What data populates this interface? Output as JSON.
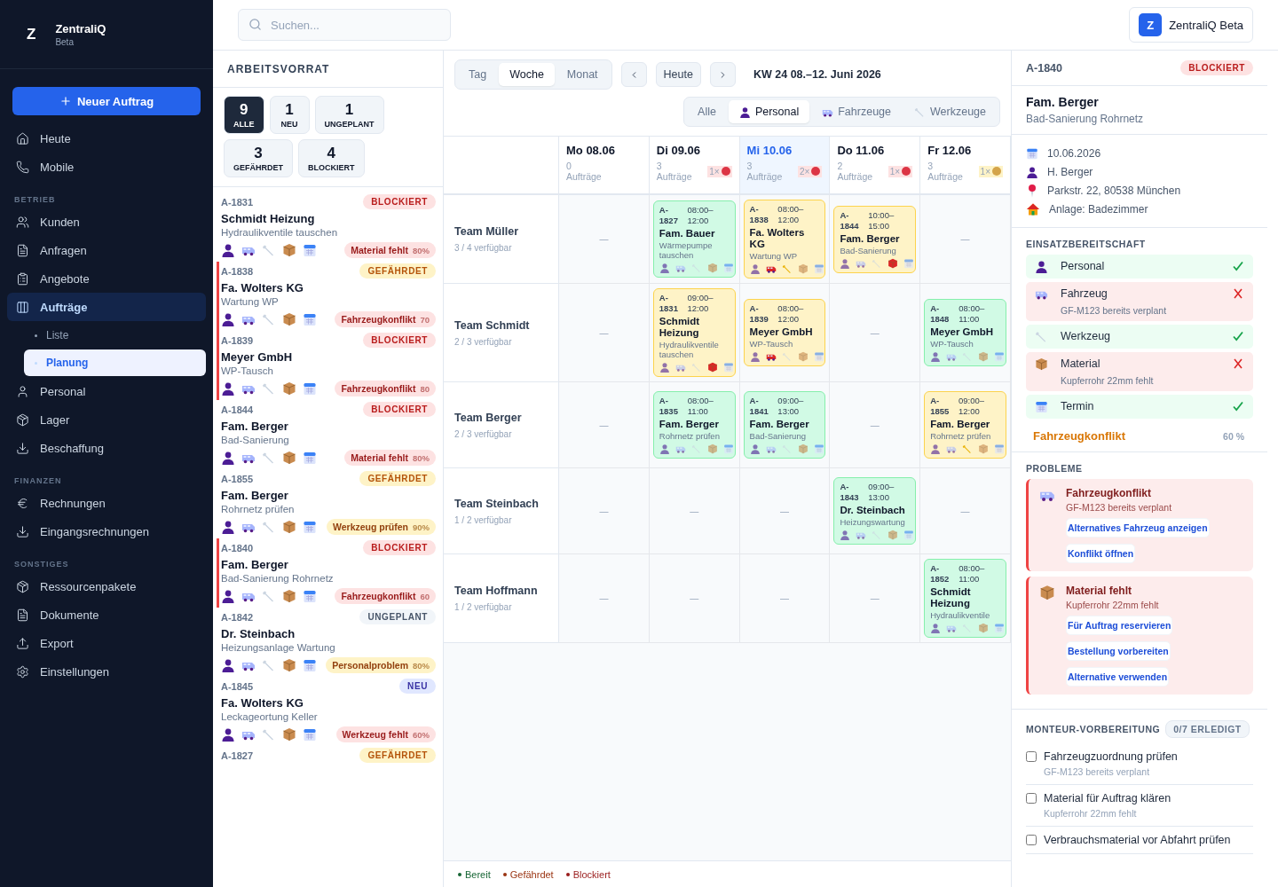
{
  "sidebar": {
    "logo": "Z",
    "app_name": "ZentraliQ",
    "app_tag": "Beta",
    "new_button": "Neuer Auftrag",
    "sections": [
      {
        "items": [
          {
            "label": "Heute",
            "selected": false
          },
          {
            "label": "Mobile",
            "selected": false
          }
        ]
      },
      {
        "title": "BETRIEB",
        "items": [
          {
            "label": "Kunden",
            "selected": false
          },
          {
            "label": "Anfragen",
            "selected": false
          },
          {
            "label": "Angebote",
            "selected": false
          },
          {
            "label": "Aufträge",
            "selected": true,
            "children": [
              {
                "label": "Liste",
                "selected": false
              },
              {
                "label": "Planung",
                "selected": true
              }
            ]
          },
          {
            "label": "Personal",
            "selected": false
          },
          {
            "label": "Lager",
            "selected": false
          },
          {
            "label": "Beschaffung",
            "selected": false
          }
        ]
      },
      {
        "title": "FINANZEN",
        "items": [
          {
            "label": "Rechnungen",
            "selected": false
          },
          {
            "label": "Eingangsrechnungen",
            "selected": false
          }
        ]
      },
      {
        "title": "SONSTIGES",
        "items": [
          {
            "label": "Ressourcenpakete",
            "selected": false
          },
          {
            "label": "Dokumente",
            "selected": false
          },
          {
            "label": "Export",
            "selected": false
          },
          {
            "label": "Einstellungen",
            "selected": false
          }
        ]
      }
    ]
  },
  "topbar": {
    "search": {
      "placeholder": "Suchen..."
    },
    "brand": {
      "logo": "Z",
      "label": "ZentraliQ Beta"
    }
  },
  "backlog": {
    "title": "ARBEITSVORRAT",
    "filters": [
      {
        "count": "9",
        "label": "ALLE",
        "selected": true
      },
      {
        "count": "1",
        "label": "NEU",
        "selected": false
      },
      {
        "count": "1",
        "label": "UNGEPLANT",
        "selected": false
      },
      {
        "count": "3",
        "label": "GEFÄHRDET",
        "selected": false
      },
      {
        "count": "4",
        "label": "BLOCKIERT",
        "selected": false
      }
    ],
    "items": [
      {
        "id": "A-1831",
        "status": {
          "label": "BLOCKIERT",
          "kind": "blocked"
        },
        "flagged": false,
        "customer": "Schmidt Heizung",
        "task": "Hydraulikventile tauschen",
        "issue": {
          "label": "Material fehlt",
          "percent": "80%",
          "kind": "blocked"
        }
      },
      {
        "id": "A-1838",
        "status": {
          "label": "GEFÄHRDET",
          "kind": "risk"
        },
        "flagged": true,
        "customer": "Fa. Wolters KG",
        "task": "Wartung WP",
        "issue": {
          "label": "Fahrzeugkonflikt",
          "percent": "70",
          "kind": "blocked"
        }
      },
      {
        "id": "A-1839",
        "status": {
          "label": "BLOCKIERT",
          "kind": "blocked"
        },
        "flagged": true,
        "customer": "Meyer GmbH",
        "task": "WP-Tausch",
        "issue": {
          "label": "Fahrzeugkonflikt",
          "percent": "80",
          "kind": "blocked"
        }
      },
      {
        "id": "A-1844",
        "status": {
          "label": "BLOCKIERT",
          "kind": "blocked"
        },
        "flagged": false,
        "customer": "Fam. Berger",
        "task": "Bad-Sanierung",
        "issue": {
          "label": "Material fehlt",
          "percent": "80%",
          "kind": "blocked"
        }
      },
      {
        "id": "A-1855",
        "status": {
          "label": "GEFÄHRDET",
          "kind": "risk"
        },
        "flagged": false,
        "customer": "Fam. Berger",
        "task": "Rohrnetz prüfen",
        "issue": {
          "label": "Werkzeug prüfen",
          "percent": "90%",
          "kind": "risk"
        }
      },
      {
        "id": "A-1840",
        "status": {
          "label": "BLOCKIERT",
          "kind": "blocked"
        },
        "flagged": true,
        "customer": "Fam. Berger",
        "task": "Bad-Sanierung Rohrnetz",
        "issue": {
          "label": "Fahrzeugkonflikt",
          "percent": "60",
          "kind": "blocked"
        }
      },
      {
        "id": "A-1842",
        "status": {
          "label": "UNGEPLANT",
          "kind": "unplanned"
        },
        "flagged": false,
        "customer": "Dr. Steinbach",
        "task": "Heizungsanlage Wartung",
        "issue": {
          "label": "Personalproblem",
          "percent": "80%",
          "kind": "risk"
        }
      },
      {
        "id": "A-1845",
        "status": {
          "label": "NEU",
          "kind": "new"
        },
        "flagged": false,
        "customer": "Fa. Wolters KG",
        "task": "Leckageortung Keller",
        "issue": {
          "label": "Werkzeug fehlt",
          "percent": "60%",
          "kind": "blocked"
        }
      },
      {
        "id": "A-1827",
        "status": {
          "label": "GEFÄHRDET",
          "kind": "risk"
        },
        "flagged": false
      }
    ]
  },
  "calendar": {
    "views": [
      {
        "label": "Tag",
        "selected": false
      },
      {
        "label": "Woche",
        "selected": true
      },
      {
        "label": "Monat",
        "selected": false
      }
    ],
    "today_button": "Heute",
    "period": "KW 24 08.–12. Juni 2026",
    "resource_filters": [
      {
        "label": "Alle",
        "selected": false
      },
      {
        "label": "Personal",
        "selected": true
      },
      {
        "label": "Fahrzeuge",
        "selected": false
      },
      {
        "label": "Werkzeuge",
        "selected": false
      }
    ],
    "days": [
      {
        "label": "Mo 08.06",
        "count": "0 Aufträge",
        "today": false
      },
      {
        "label": "Di 09.06",
        "count": "3 Aufträge",
        "today": false,
        "alert": {
          "text": "1×",
          "kind": "blocked"
        }
      },
      {
        "label": "Mi 10.06",
        "count": "3 Aufträge",
        "today": true,
        "alert": {
          "text": "2×",
          "kind": "blocked"
        }
      },
      {
        "label": "Do 11.06",
        "count": "2 Aufträge",
        "today": false,
        "alert": {
          "text": "1×",
          "kind": "blocked"
        }
      },
      {
        "label": "Fr 12.06",
        "count": "3 Aufträge",
        "today": false,
        "alert": {
          "text": "1×",
          "kind": "risk"
        }
      }
    ],
    "teams": [
      {
        "name": "Team Müller",
        "availability": "3 / 4 verfügbar",
        "cells": [
          {
            "kind": "empty",
            "text": "—"
          },
          {
            "kind": "card",
            "at_risk": false,
            "id": "A-1827",
            "time": "08:00–12:00",
            "customer": "Fam. Bauer",
            "task": "Wärmepumpe tauschen",
            "resources": [
              {
                "conflict": false,
                "warning": false
              },
              {
                "conflict": false,
                "warning": false
              },
              {
                "conflict": false,
                "warning": false
              },
              {
                "conflict": false,
                "warning": false
              },
              {
                "conflict": false,
                "warning": false
              }
            ]
          },
          {
            "kind": "card",
            "at_risk": true,
            "id": "A-1838",
            "time": "08:00–12:00",
            "customer": "Fa. Wolters KG",
            "task": "Wartung WP",
            "resources": [
              {
                "conflict": false,
                "warning": false
              },
              {
                "conflict": true,
                "warning": false
              },
              {
                "conflict": false,
                "warning": true
              },
              {
                "conflict": false,
                "warning": false
              },
              {
                "conflict": false,
                "warning": false
              }
            ]
          },
          {
            "kind": "card",
            "at_risk": true,
            "id": "A-1844",
            "time": "10:00–15:00",
            "customer": "Fam. Berger",
            "task": "Bad-Sanierung",
            "resources": [
              {
                "conflict": false,
                "warning": false
              },
              {
                "conflict": false,
                "warning": false
              },
              {
                "conflict": false,
                "warning": false
              },
              {
                "conflict": true,
                "warning": false
              },
              {
                "conflict": false,
                "warning": false
              }
            ]
          },
          {
            "kind": "empty",
            "text": "—"
          }
        ]
      },
      {
        "name": "Team Schmidt",
        "availability": "2 / 3 verfügbar",
        "cells": [
          {
            "kind": "empty",
            "text": "—"
          },
          {
            "kind": "card",
            "at_risk": true,
            "id": "A-1831",
            "time": "09:00–12:00",
            "customer": "Schmidt Heizung",
            "task": "Hydraulikventile tauschen",
            "resources": [
              {
                "conflict": false,
                "warning": false
              },
              {
                "conflict": false,
                "warning": false
              },
              {
                "conflict": false,
                "warning": false
              },
              {
                "conflict": true,
                "warning": false
              },
              {
                "conflict": false,
                "warning": false
              }
            ]
          },
          {
            "kind": "card",
            "at_risk": true,
            "id": "A-1839",
            "time": "08:00–12:00",
            "customer": "Meyer GmbH",
            "task": "WP-Tausch",
            "resources": [
              {
                "conflict": false,
                "warning": false
              },
              {
                "conflict": true,
                "warning": false
              },
              {
                "conflict": false,
                "warning": false
              },
              {
                "conflict": false,
                "warning": false
              },
              {
                "conflict": false,
                "warning": false
              }
            ]
          },
          {
            "kind": "empty",
            "text": "—"
          },
          {
            "kind": "card",
            "at_risk": false,
            "id": "A-1848",
            "time": "08:00–11:00",
            "customer": "Meyer GmbH",
            "task": "WP-Tausch",
            "resources": [
              {
                "conflict": false,
                "warning": false
              },
              {
                "conflict": false,
                "warning": false
              },
              {
                "conflict": false,
                "warning": false
              },
              {
                "conflict": false,
                "warning": false
              },
              {
                "conflict": false,
                "warning": false
              }
            ]
          }
        ]
      },
      {
        "name": "Team Berger",
        "availability": "2 / 3 verfügbar",
        "cells": [
          {
            "kind": "empty",
            "text": "—"
          },
          {
            "kind": "card",
            "at_risk": false,
            "id": "A-1835",
            "time": "08:00–11:00",
            "customer": "Fam. Berger",
            "task": "Rohrnetz prüfen",
            "resources": [
              {
                "conflict": false,
                "warning": false
              },
              {
                "conflict": false,
                "warning": false
              },
              {
                "conflict": false,
                "warning": false
              },
              {
                "conflict": false,
                "warning": false
              },
              {
                "conflict": false,
                "warning": false
              }
            ]
          },
          {
            "kind": "card",
            "at_risk": false,
            "id": "A-1841",
            "time": "09:00–13:00",
            "customer": "Fam. Berger",
            "task": "Bad-Sanierung",
            "resources": [
              {
                "conflict": false,
                "warning": false
              },
              {
                "conflict": false,
                "warning": false
              },
              {
                "conflict": false,
                "warning": false
              },
              {
                "conflict": false,
                "warning": false
              },
              {
                "conflict": false,
                "warning": false
              }
            ]
          },
          {
            "kind": "empty",
            "text": "—"
          },
          {
            "kind": "card",
            "at_risk": true,
            "id": "A-1855",
            "time": "09:00–12:00",
            "customer": "Fam. Berger",
            "task": "Rohrnetz prüfen",
            "resources": [
              {
                "conflict": false,
                "warning": false
              },
              {
                "conflict": false,
                "warning": false
              },
              {
                "conflict": false,
                "warning": true
              },
              {
                "conflict": false,
                "warning": false
              },
              {
                "conflict": false,
                "warning": false
              }
            ]
          }
        ]
      },
      {
        "name": "Team Steinbach",
        "availability": "1 / 2 verfügbar",
        "cells": [
          {
            "kind": "empty",
            "text": "—"
          },
          {
            "kind": "empty",
            "text": "—"
          },
          {
            "kind": "empty",
            "text": "—"
          },
          {
            "kind": "card",
            "at_risk": false,
            "id": "A-1843",
            "time": "09:00–13:00",
            "customer": "Dr. Steinbach",
            "task": "Heizungswartung",
            "resources": [
              {
                "conflict": false,
                "warning": false
              },
              {
                "conflict": false,
                "warning": false
              },
              {
                "conflict": false,
                "warning": false
              },
              {
                "conflict": false,
                "warning": false
              },
              {
                "conflict": false,
                "warning": false
              }
            ]
          },
          {
            "kind": "empty",
            "text": "—"
          }
        ]
      },
      {
        "name": "Team Hoffmann",
        "availability": "1 / 2 verfügbar",
        "cells": [
          {
            "kind": "empty",
            "text": "—"
          },
          {
            "kind": "empty",
            "text": "—"
          },
          {
            "kind": "empty",
            "text": "—"
          },
          {
            "kind": "empty",
            "text": "—"
          },
          {
            "kind": "card",
            "at_risk": false,
            "id": "A-1852",
            "time": "08:00–11:00",
            "customer": "Schmidt Heizung",
            "task": "Hydraulikventile",
            "resources": [
              {
                "conflict": false,
                "warning": false
              },
              {
                "conflict": false,
                "warning": false
              },
              {
                "conflict": false,
                "warning": false
              },
              {
                "conflict": false,
                "warning": false
              },
              {
                "conflict": false,
                "warning": false
              }
            ]
          }
        ]
      }
    ],
    "legend": [
      {
        "label": "Bereit",
        "kind": "ready"
      },
      {
        "label": "Gefährdet",
        "kind": "risk"
      },
      {
        "label": "Blockiert",
        "kind": "blocked"
      }
    ]
  },
  "detail": {
    "id": "A-1840",
    "status": {
      "label": "BLOCKIERT",
      "kind": "blocked"
    },
    "customer": "Fam. Berger",
    "task": "Bad-Sanierung Rohrnetz",
    "info": [
      {
        "kind": "date",
        "text": "10.06.2026"
      },
      {
        "kind": "person",
        "text": "H. Berger"
      },
      {
        "kind": "address",
        "text": "Parkstr. 22, 80538 München"
      },
      {
        "kind": "site",
        "text": "Anlage: Badezimmer"
      }
    ],
    "readiness_title": "EINSATZBEREITSCHAFT",
    "readiness": [
      {
        "kind": "person",
        "label": "Personal",
        "ok": true
      },
      {
        "kind": "vehicle",
        "label": "Fahrzeug",
        "ok": false,
        "note": "GF-M123 bereits verplant"
      },
      {
        "kind": "tool",
        "label": "Werkzeug",
        "ok": true
      },
      {
        "kind": "material",
        "label": "Material",
        "ok": false,
        "note": "Kupferrohr 22mm fehlt"
      },
      {
        "kind": "date",
        "label": "Termin",
        "ok": true
      }
    ],
    "summary": {
      "label": "Fahrzeugkonflikt",
      "percent": "60 %"
    },
    "problems_title": "PROBLEME",
    "problems": [
      {
        "kind": "vehicle",
        "title": "Fahrzeugkonflikt",
        "desc": "GF-M123 bereits verplant",
        "actions": [
          "Alternatives Fahrzeug anzeigen",
          "Konflikt öffnen"
        ]
      },
      {
        "kind": "material",
        "title": "Material fehlt",
        "desc": "Kupferrohr 22mm fehlt",
        "actions": [
          "Für Auftrag reservieren",
          "Bestellung vorbereiten",
          "Alternative verwenden"
        ]
      }
    ],
    "checklist_title": "MONTEUR-VORBEREITUNG",
    "checklist_badge": "0/7 ERLEDIGT",
    "checklist": [
      {
        "label": "Fahrzeugzuordnung prüfen",
        "note": "GF-M123 bereits verplant",
        "checked": false
      },
      {
        "label": "Material für Auftrag klären",
        "note": "Kupferrohr 22mm fehlt",
        "checked": false
      },
      {
        "label": "Verbrauchsmaterial vor Abfahrt prüfen",
        "checked": false
      }
    ]
  }
}
